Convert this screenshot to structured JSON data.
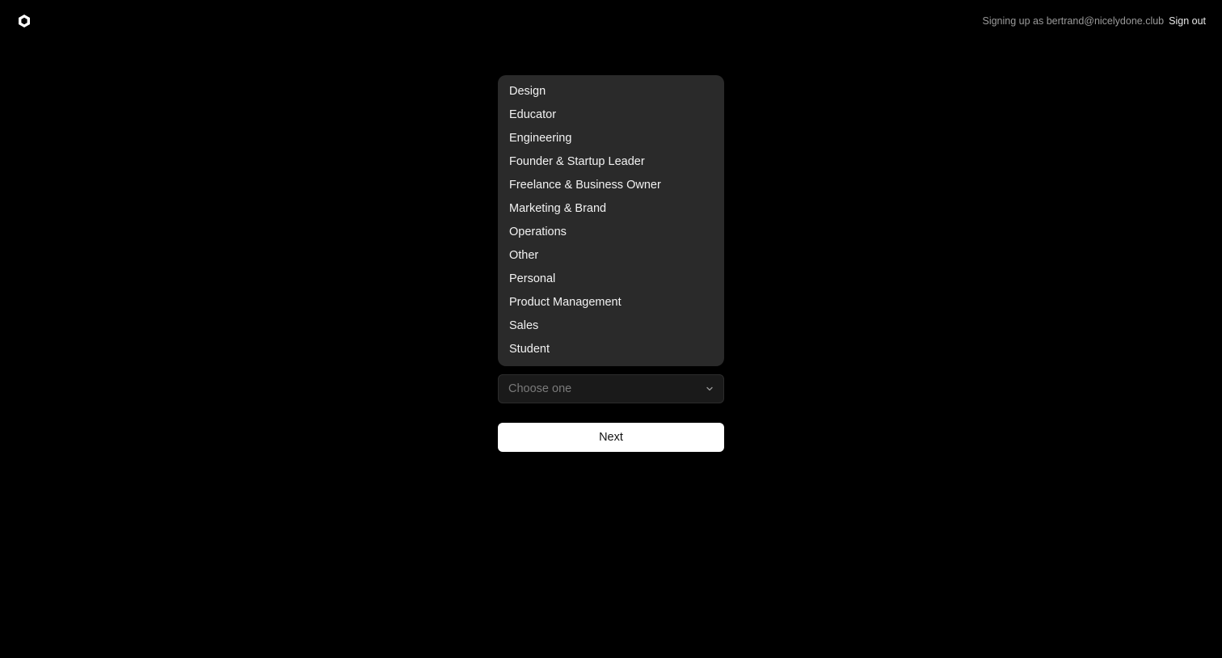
{
  "header": {
    "logo_icon": "hexagon-logo-icon",
    "signing_up_text": "Signing up as bertrand@nicelydone.club",
    "sign_out_label": "Sign out"
  },
  "dropdown": {
    "options": [
      "Design",
      "Educator",
      "Engineering",
      "Founder & Startup Leader",
      "Freelance & Business Owner",
      "Marketing & Brand",
      "Operations",
      "Other",
      "Personal",
      "Product Management",
      "Sales",
      "Student"
    ]
  },
  "select": {
    "placeholder": "Choose one",
    "icon": "chevron-down-icon"
  },
  "actions": {
    "next_label": "Next"
  },
  "colors": {
    "background": "#000000",
    "menu_background": "#2a2a2a",
    "button_background": "#ffffff"
  }
}
